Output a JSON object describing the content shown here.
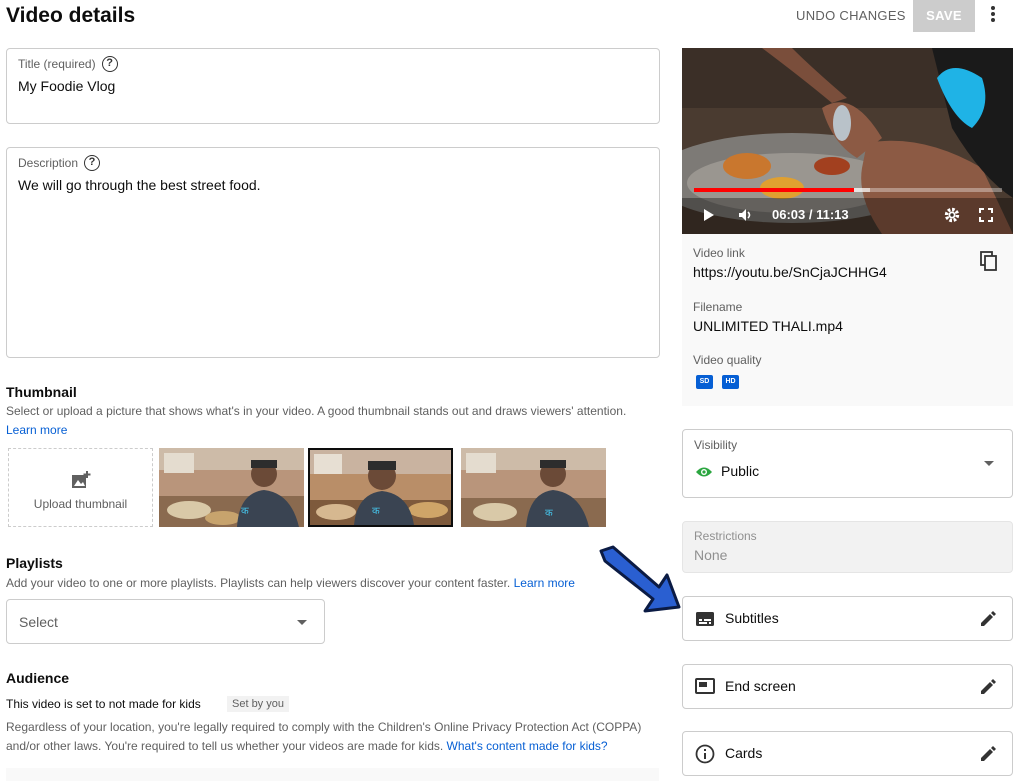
{
  "header": {
    "title": "Video details",
    "undo_label": "UNDO CHANGES",
    "save_label": "SAVE",
    "more_icon": "more-vert-icon"
  },
  "title_field": {
    "label": "Title (required)",
    "value": "My Foodie Vlog",
    "help_icon": "?"
  },
  "description_field": {
    "label": "Description",
    "value": "We will go through the best street food.",
    "help_icon": "?"
  },
  "thumbnail": {
    "title": "Thumbnail",
    "description": "Select or upload a picture that shows what's in your video. A good thumbnail stands out and draws viewers' attention.",
    "learn_more": "Learn more",
    "upload_label": "Upload thumbnail",
    "options": [
      {
        "selected": false
      },
      {
        "selected": true
      },
      {
        "selected": false
      }
    ]
  },
  "playlists": {
    "title": "Playlists",
    "description": "Add your video to one or more playlists. Playlists can help viewers discover your content faster.",
    "learn_more": "Learn more",
    "select_value": "Select"
  },
  "audience": {
    "title": "Audience",
    "status": "This video is set to not made for kids",
    "chip": "Set by you",
    "description": "Regardless of your location, you're legally required to comply with the Children's Online Privacy Protection Act (COPPA) and/or other laws. You're required to tell us whether your videos are made for kids.",
    "link": "What's content made for kids?"
  },
  "video": {
    "time": "06:03 / 11:13",
    "progress_played": 0.52,
    "progress_buffered": 0.57,
    "link_label": "Video link",
    "link_url": "https://youtu.be/SnCjaJCHHG4",
    "filename_label": "Filename",
    "filename": "UNLIMITED THALI.mp4",
    "quality_label": "Video quality",
    "quality_badges": [
      "SD",
      "HD"
    ]
  },
  "visibility": {
    "label": "Visibility",
    "value": "Public"
  },
  "restrictions": {
    "label": "Restrictions",
    "value": "None"
  },
  "side_actions": [
    {
      "label": "Subtitles",
      "icon": "subtitles-icon"
    },
    {
      "label": "End screen",
      "icon": "end-screen-icon"
    },
    {
      "label": "Cards",
      "icon": "info-icon"
    }
  ],
  "colors": {
    "accent": "#065fd4",
    "progress": "#ff0000",
    "arrow": "#2a5fd1",
    "public_eye": "#2ba640"
  }
}
